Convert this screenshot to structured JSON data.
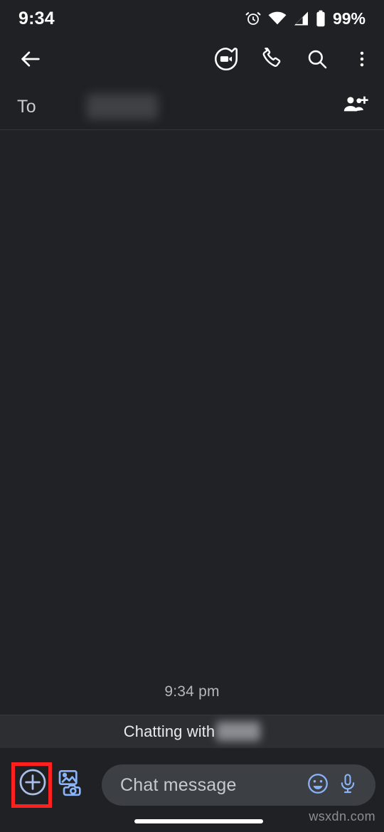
{
  "status_bar": {
    "time": "9:34",
    "battery_percent": "99%",
    "icons": [
      "alarm-icon",
      "wifi-icon",
      "cellular-signal-icon",
      "battery-icon"
    ]
  },
  "toolbar": {
    "back_icon": "back-arrow-icon",
    "video_call_icon": "video-call-icon",
    "phone_call_icon": "phone-call-icon",
    "search_icon": "search-icon",
    "overflow_icon": "more-vert-icon"
  },
  "recipient_row": {
    "to_label": "To",
    "recipient_value": "",
    "add_people_icon": "add-people-icon"
  },
  "thread": {
    "timestamp": "9:34 pm"
  },
  "chatting_banner": {
    "prefix": "Chatting with",
    "contact_name": ""
  },
  "compose": {
    "plus_icon": "add-circle-icon",
    "gallery_icon": "gallery-camera-icon",
    "placeholder": "Chat message",
    "input_value": "",
    "emoji_icon": "emoji-icon",
    "mic_icon": "microphone-icon"
  },
  "highlight": {
    "color": "#ff2020",
    "target": "add-circle-icon"
  },
  "watermark": {
    "text": "wsxdn.com"
  },
  "colors": {
    "background": "#202124",
    "thread_background": "#212225",
    "banner_background": "#2c2e32",
    "input_background": "#3c3f43",
    "accent_blue": "#8ab4f8",
    "text_primary": "#ffffff",
    "text_secondary": "#c6c9ce"
  }
}
